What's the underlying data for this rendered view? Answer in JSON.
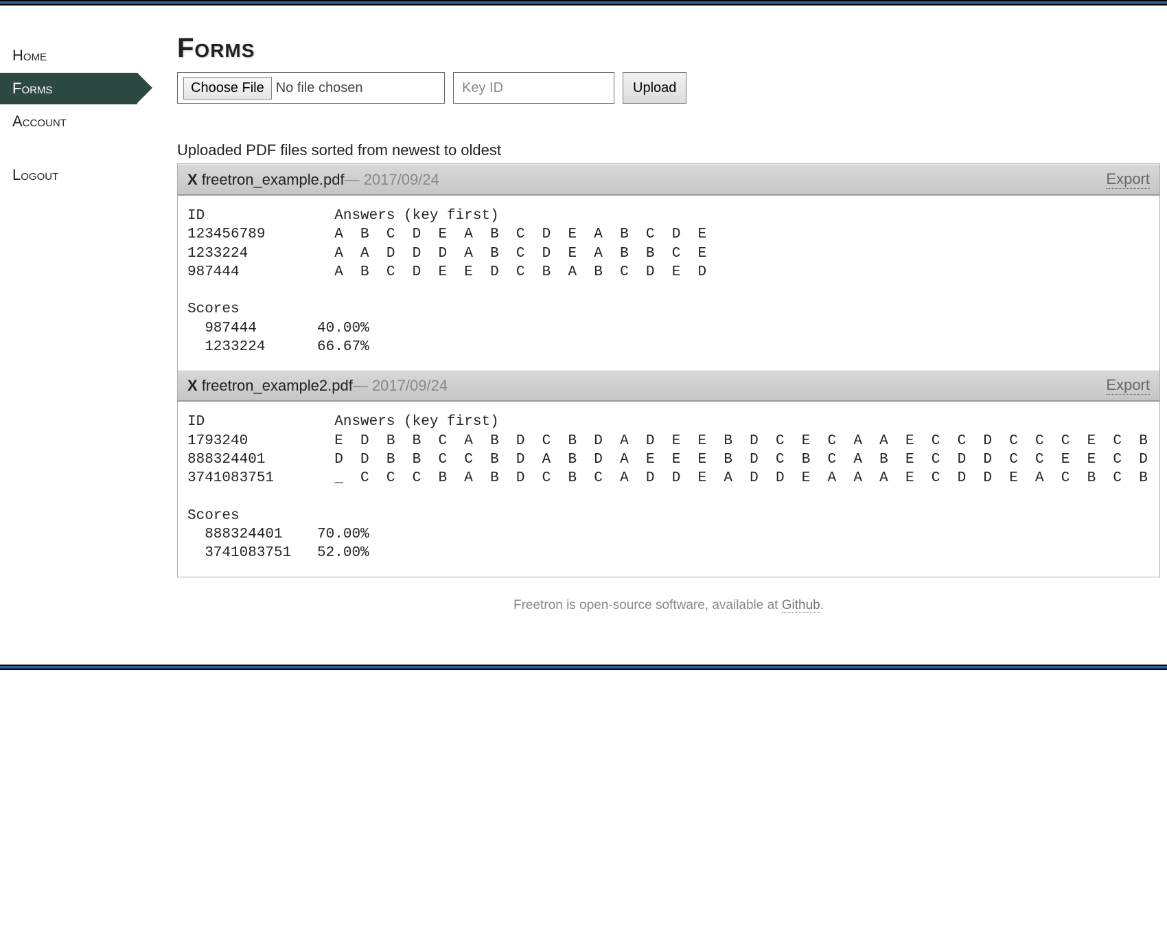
{
  "sidebar": {
    "items": [
      {
        "label": "Home",
        "active": false
      },
      {
        "label": "Forms",
        "active": true
      },
      {
        "label": "Account",
        "active": false
      }
    ],
    "logout_label": "Logout"
  },
  "page": {
    "title": "Forms",
    "subtitle": "Uploaded PDF files sorted from newest to oldest"
  },
  "upload": {
    "choose_file_label": "Choose File",
    "no_file_text": "No file chosen",
    "key_placeholder": "Key ID",
    "upload_label": "Upload"
  },
  "files": [
    {
      "delete_label": "X",
      "name": "freetron_example.pdf",
      "date": "— 2017/09/24",
      "export_label": "Export",
      "body": "ID               Answers (key first)\n123456789        A  B  C  D  E  A  B  C  D  E  A  B  C  D  E\n1233224          A  A  D  D  D  A  B  C  D  E  A  B  B  C  E\n987444           A  B  C  D  E  E  D  C  B  A  B  C  D  E  D\n\nScores\n  987444       40.00%\n  1233224      66.67%"
    },
    {
      "delete_label": "X",
      "name": "freetron_example2.pdf",
      "date": "— 2017/09/24",
      "export_label": "Export",
      "body": "ID               Answers (key first)\n1793240          E  D  B  B  C  A  B  D  C  B  D  A  D  E  E  B  D  C  E  C  A  A  E  C  C  D  C  C  C  E  C  B\n888324401        D  D  B  B  C  C  B  D  A  B  D  A  E  E  E  B  D  C  B  C  A  B  E  C  D  D  C  C  E  E  C  D\n3741083751       _  C  C  C  B  A  B  D  C  B  C  A  D  D  E  A  D  D  E  A  A  A  E  C  D  D  E  A  C  B  C  B\n\nScores\n  888324401    70.00%\n  3741083751   52.00%"
    }
  ],
  "footer": {
    "text_prefix": "Freetron is open-source software, available at ",
    "link_label": "Github",
    "text_suffix": "."
  }
}
